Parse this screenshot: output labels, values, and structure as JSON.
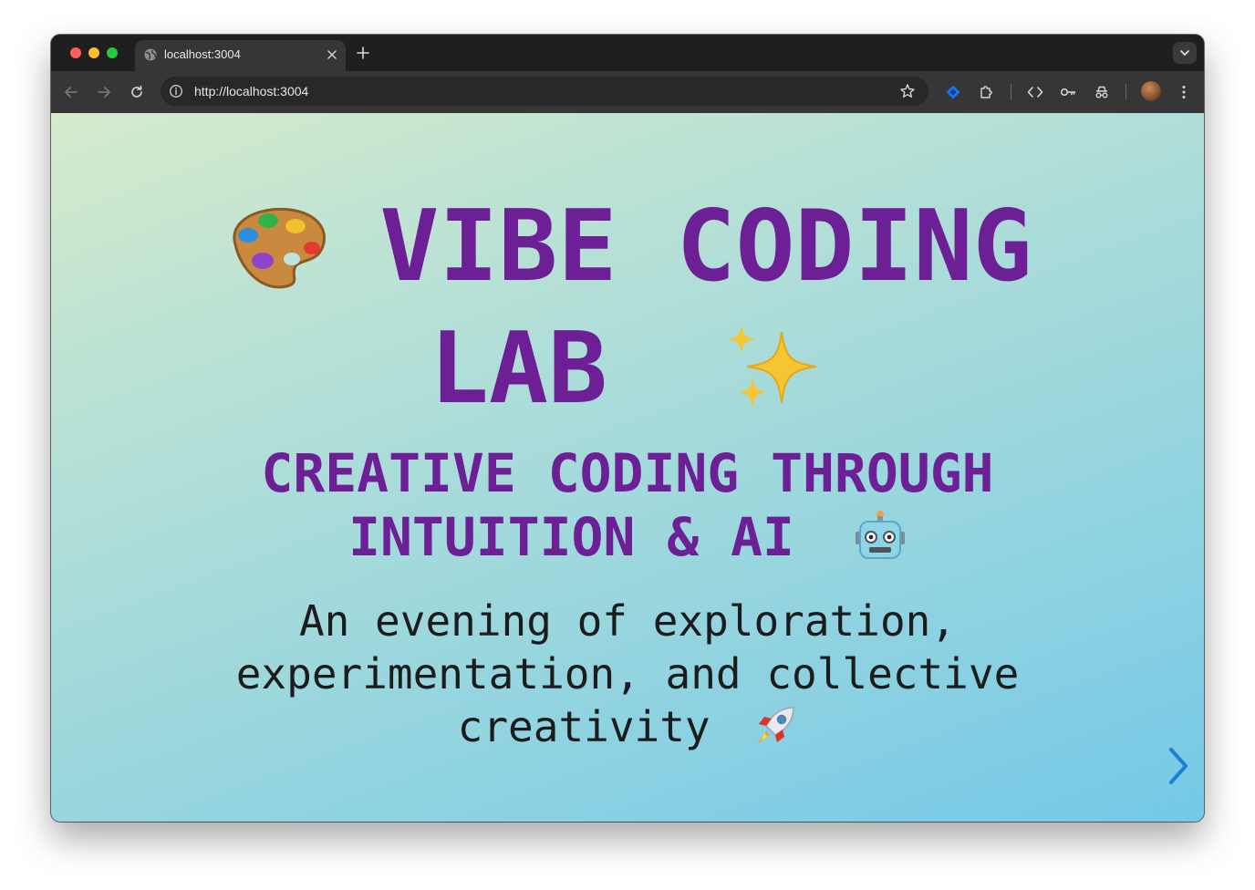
{
  "browser": {
    "tab_title": "localhost:3004",
    "url": "http://localhost:3004"
  },
  "slide": {
    "title_line1": "VIBE CODING",
    "title_line2": "LAB",
    "subtitle_line1": "CREATIVE CODING THROUGH",
    "subtitle_line2": "INTUITION & AI",
    "tagline_line1": "An evening of exploration,",
    "tagline_line2": "experimentation, and collective",
    "tagline_line3": "creativity",
    "emojis": [
      "palette-icon",
      "sparkles-icon",
      "robot-icon",
      "rocket-icon"
    ],
    "title_color": "#6d1f96",
    "text_color": "#1c1c1c",
    "accent_arrow_color": "#1e7fd6"
  }
}
